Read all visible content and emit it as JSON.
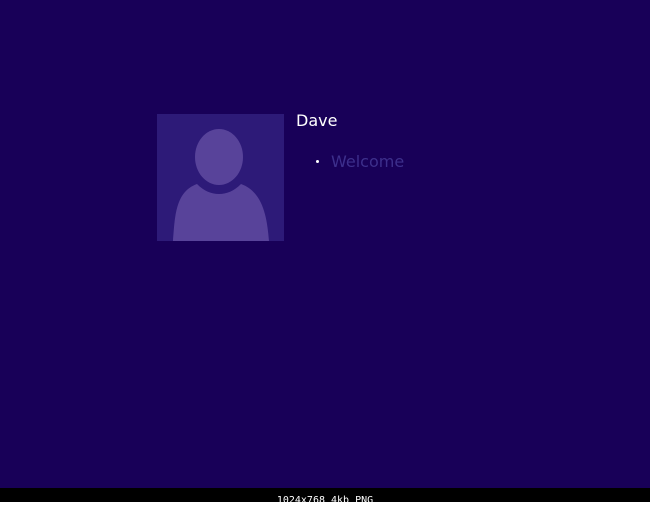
{
  "login": {
    "user_name": "Dave",
    "status_text": "Welcome",
    "avatar_icon": "user-avatar-icon"
  },
  "viewer_status": {
    "info": "1024x768 4kb PNG"
  },
  "colors": {
    "background": "#180058",
    "avatar_tile": "#2d1a78",
    "avatar_silhouette": "#58439a",
    "status_text": "#3d2f8c",
    "status_bar": "#000000"
  }
}
